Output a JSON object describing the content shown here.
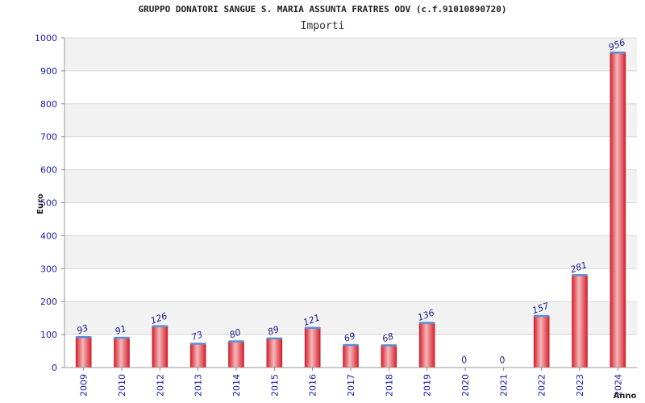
{
  "chart_data": {
    "type": "bar",
    "title": "GRUPPO DONATORI SANGUE S. MARIA ASSUNTA FRATRES ODV (c.f.91010890720)",
    "subtitle": "Importi",
    "xlabel": "Anno",
    "ylabel": "Euro",
    "categories": [
      "2009",
      "2010",
      "2012",
      "2013",
      "2014",
      "2015",
      "2016",
      "2017",
      "2018",
      "2019",
      "2020",
      "2021",
      "2022",
      "2023",
      "2024"
    ],
    "values": [
      93,
      91,
      126,
      73,
      80,
      89,
      121,
      69,
      68,
      136,
      0,
      0,
      157,
      281,
      956
    ],
    "ylim": [
      0,
      1000
    ],
    "yticks": [
      0,
      100,
      200,
      300,
      400,
      500,
      600,
      700,
      800,
      900,
      1000
    ],
    "grid": true,
    "colors": {
      "bar": "#e8323c",
      "bar_highlight": "#f2b8bc",
      "bar_top": "#5b8fd6",
      "band": "#f2f2f2",
      "tick": "#1a1aa6"
    }
  }
}
